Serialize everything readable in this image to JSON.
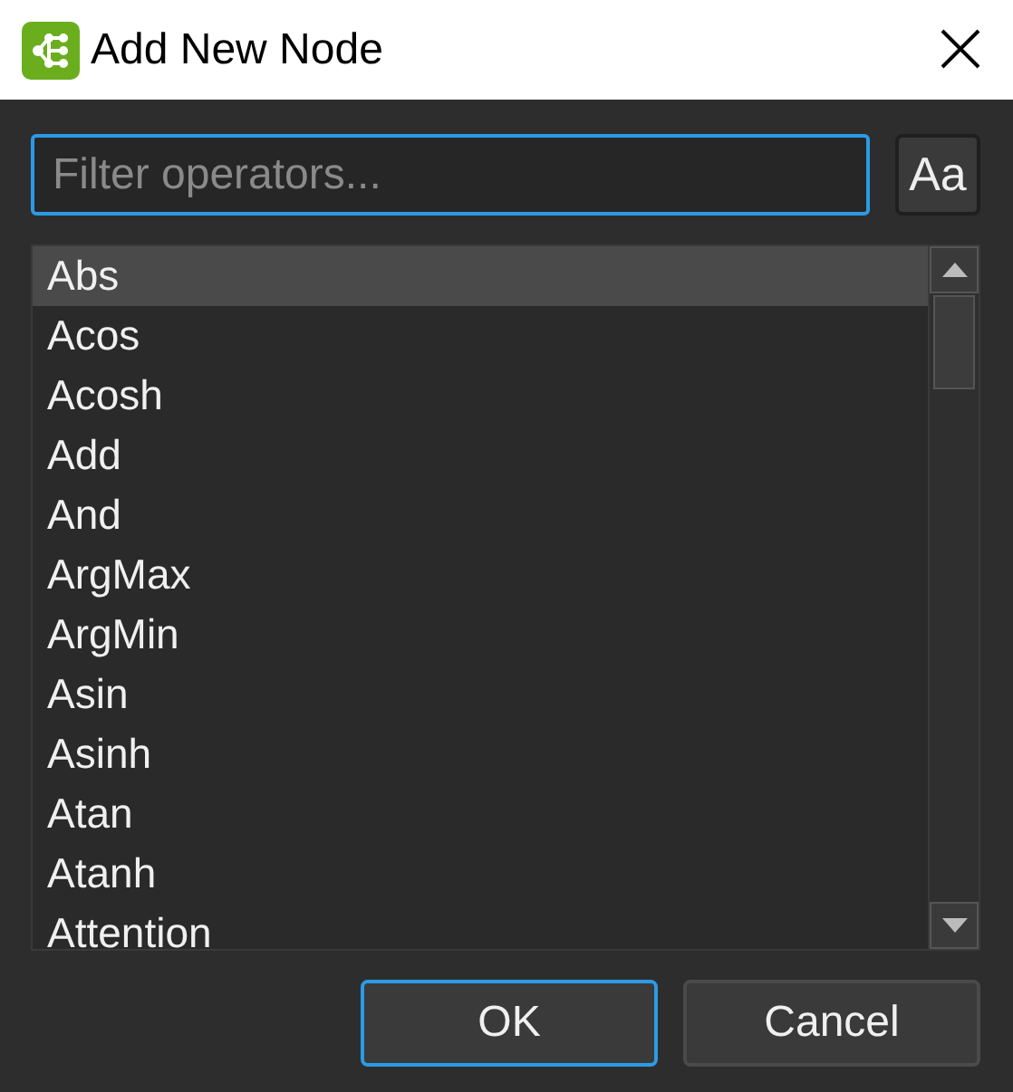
{
  "window": {
    "title": "Add New Node"
  },
  "filter": {
    "placeholder": "Filter operators..."
  },
  "match_case_button": {
    "label": "Aa"
  },
  "operators": [
    {
      "label": "Abs",
      "selected": true
    },
    {
      "label": "Acos",
      "selected": false
    },
    {
      "label": "Acosh",
      "selected": false
    },
    {
      "label": "Add",
      "selected": false
    },
    {
      "label": "And",
      "selected": false
    },
    {
      "label": "ArgMax",
      "selected": false
    },
    {
      "label": "ArgMin",
      "selected": false
    },
    {
      "label": "Asin",
      "selected": false
    },
    {
      "label": "Asinh",
      "selected": false
    },
    {
      "label": "Atan",
      "selected": false
    },
    {
      "label": "Atanh",
      "selected": false
    },
    {
      "label": "Attention",
      "selected": false
    }
  ],
  "buttons": [
    {
      "label": "OK",
      "kind": "default"
    },
    {
      "label": "Cancel",
      "kind": "normal"
    }
  ]
}
